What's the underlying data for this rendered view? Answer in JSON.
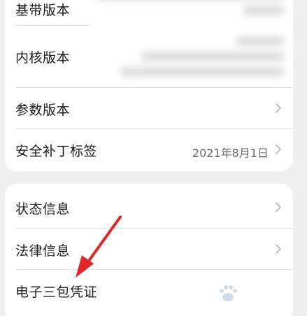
{
  "about_card": {
    "rows": [
      {
        "label": "基带版本"
      },
      {
        "label": "内核版本"
      },
      {
        "label": "参数版本"
      },
      {
        "label": "安全补丁标签",
        "value": "2021年8月1日"
      }
    ]
  },
  "info_card": {
    "rows": [
      {
        "label": "状态信息"
      },
      {
        "label": "法律信息"
      },
      {
        "label": "电子三包凭证"
      }
    ]
  },
  "icons": {
    "chevron": "chevron-right-icon",
    "annotation": "red-arrow-icon",
    "watermark": "baidu-jingyan-watermark"
  },
  "colors": {
    "background": "#efefef",
    "card": "#ffffff",
    "text": "#1b1b1b",
    "secondary_text": "#6a6a6a",
    "chevron": "#b5b5b5",
    "arrow": "#e0262b"
  }
}
